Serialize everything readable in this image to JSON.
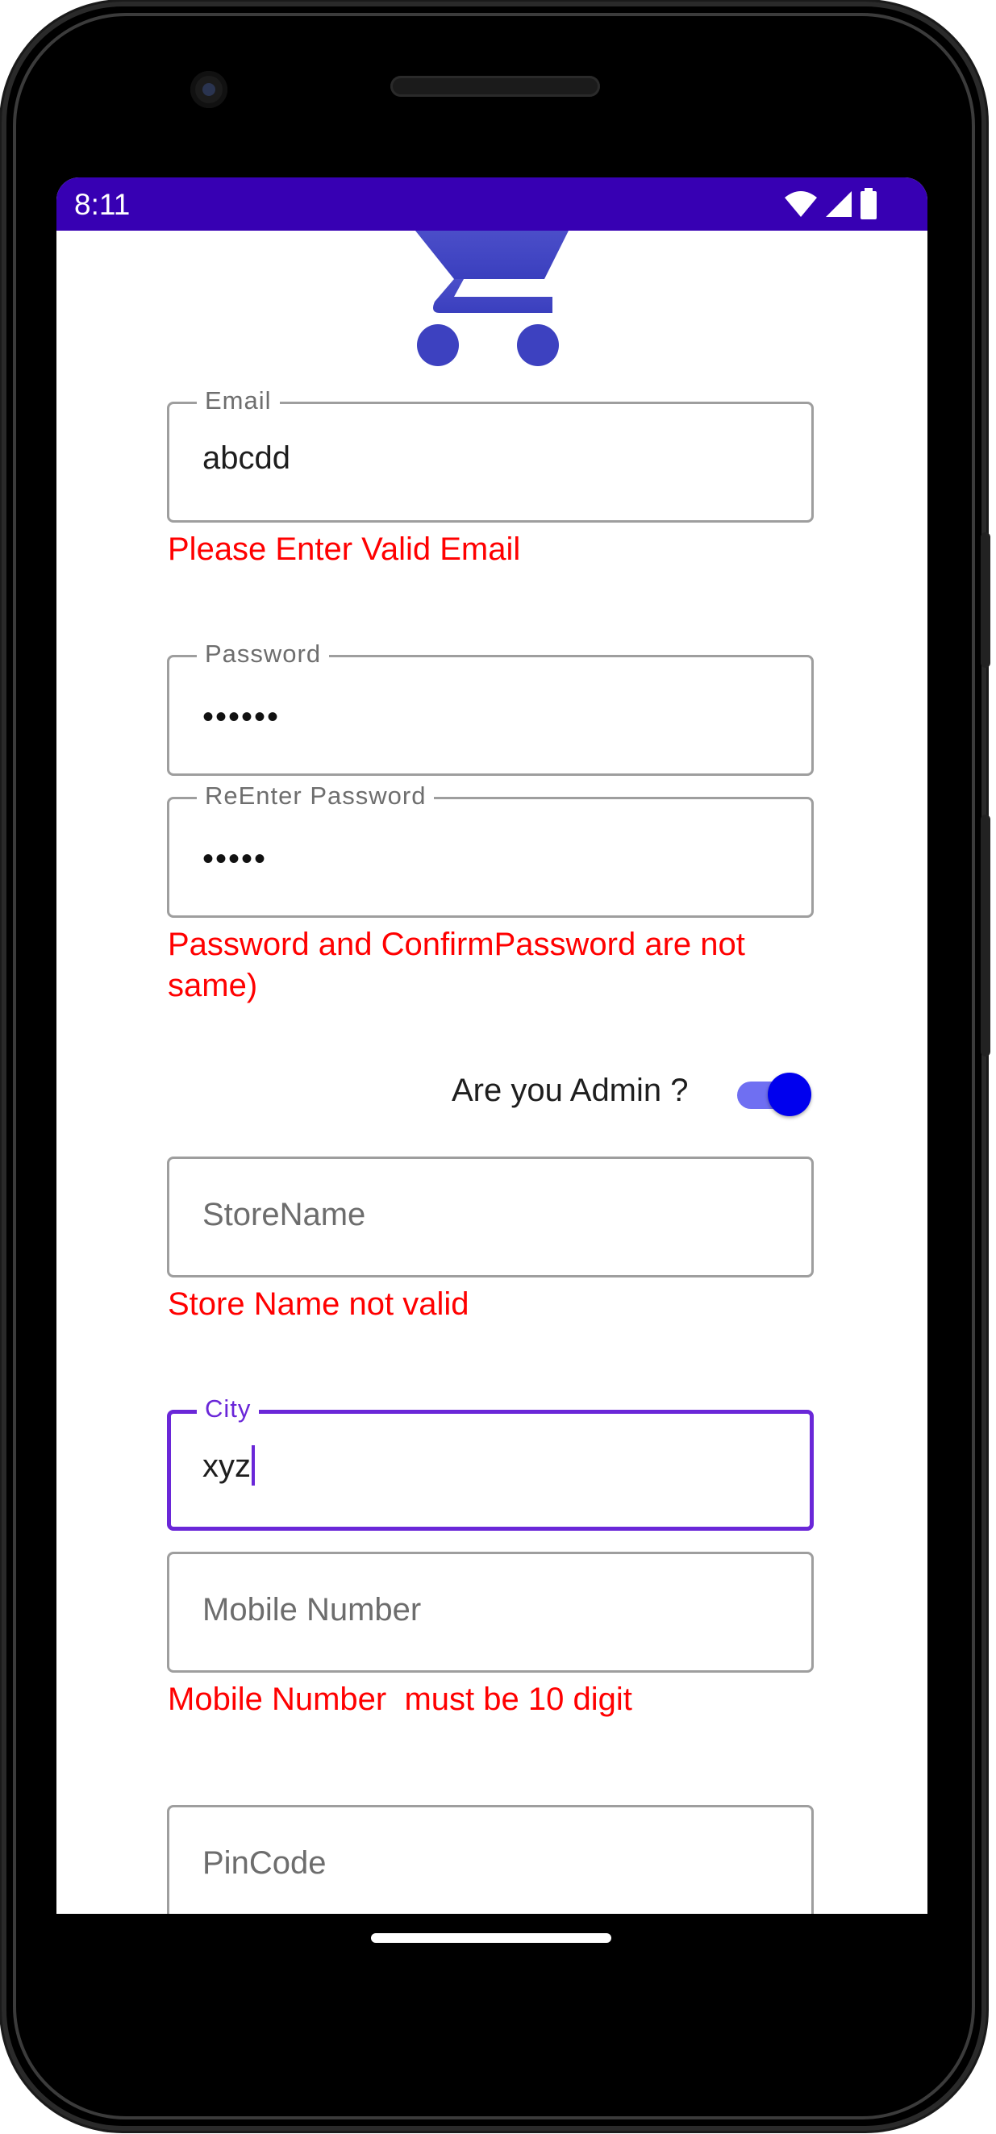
{
  "status_bar": {
    "time": "8:11",
    "icons": [
      "wifi-icon",
      "cellular-signal-icon",
      "battery-icon"
    ],
    "background": "#3700b3"
  },
  "logo": {
    "icon": "shopping-cart-icon",
    "color": "#4046c2"
  },
  "form": {
    "email": {
      "label": "Email",
      "value": "abcdd",
      "error": "Please Enter Valid Email"
    },
    "password": {
      "label": "Password",
      "value": "••••••"
    },
    "reenter_password": {
      "label": "ReEnter Password",
      "value": "•••••",
      "error": "Password and ConfirmPassword are not same)"
    },
    "admin": {
      "label": "Are you Admin ?",
      "checked": true
    },
    "store_name": {
      "placeholder": "StoreName",
      "error": "Store Name not valid"
    },
    "city": {
      "label": "City",
      "value": "xyz",
      "focused": true
    },
    "mobile": {
      "placeholder": "Mobile Number",
      "error": "Mobile Number  must be 10 digit"
    },
    "pincode": {
      "placeholder": "PinCode"
    }
  },
  "colors": {
    "error": "#ff0000",
    "focus": "#6a27d8",
    "switch_thumb": "#0000ee",
    "switch_track": "#6f6ff2"
  }
}
